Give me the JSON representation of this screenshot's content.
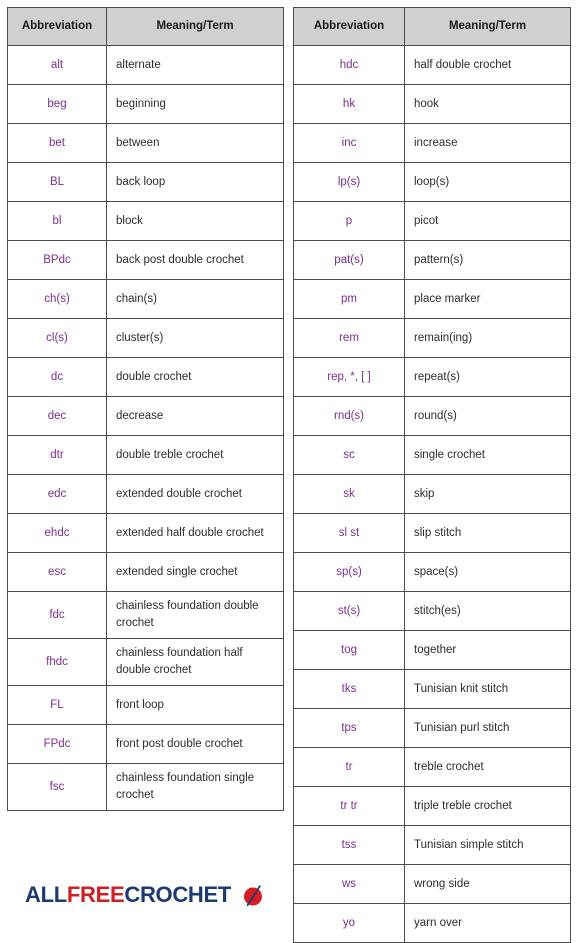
{
  "page": {
    "title": "Crochet Abbreviations Chart",
    "background_color": "#ffffff",
    "abbr_text_color": "#7a2f8f",
    "term_text_color": "#2d2d2d",
    "header_bg_color": "#d0d0d0",
    "border_color": "#4d4d4d"
  },
  "columns": {
    "abbreviation_header": "Abbreviation",
    "meaning_header": "Meaning/Term"
  },
  "left_table": {
    "headers": [
      "Abbreviation",
      "Meaning/Term"
    ],
    "rows": [
      {
        "abbr": "alt",
        "term": "alternate"
      },
      {
        "abbr": "beg",
        "term": "beginning"
      },
      {
        "abbr": "bet",
        "term": "between"
      },
      {
        "abbr": "BL",
        "term": "back loop"
      },
      {
        "abbr": "bl",
        "term": "block"
      },
      {
        "abbr": "BPdc",
        "term": "back post double crochet"
      },
      {
        "abbr": "ch(s)",
        "term": "chain(s)"
      },
      {
        "abbr": "cl(s)",
        "term": "cluster(s)"
      },
      {
        "abbr": "dc",
        "term": "double crochet"
      },
      {
        "abbr": "dec",
        "term": "decrease"
      },
      {
        "abbr": "dtr",
        "term": "double treble crochet"
      },
      {
        "abbr": "edc",
        "term": "extended double crochet"
      },
      {
        "abbr": "ehdc",
        "term": "extended half double crochet"
      },
      {
        "abbr": "esc",
        "term": "extended single crochet"
      },
      {
        "abbr": "fdc",
        "term": "chainless foundation double crochet"
      },
      {
        "abbr": "fhdc",
        "term": "chainless foundation half double crochet"
      },
      {
        "abbr": "FL",
        "term": "front loop"
      },
      {
        "abbr": "FPdc",
        "term": "front post double crochet"
      },
      {
        "abbr": "fsc",
        "term": "chainless foundation single crochet"
      }
    ]
  },
  "right_table": {
    "headers": [
      "Abbreviation",
      "Meaning/Term"
    ],
    "rows": [
      {
        "abbr": "hdc",
        "term": "half double crochet"
      },
      {
        "abbr": "hk",
        "term": "hook"
      },
      {
        "abbr": "inc",
        "term": "increase"
      },
      {
        "abbr": "lp(s)",
        "term": "loop(s)"
      },
      {
        "abbr": "p",
        "term": "picot"
      },
      {
        "abbr": "pat(s)",
        "term": "pattern(s)"
      },
      {
        "abbr": "pm",
        "term": "place marker"
      },
      {
        "abbr": "rem",
        "term": "remain(ing)"
      },
      {
        "abbr": "rep, *, [ ]",
        "term": "repeat(s)"
      },
      {
        "abbr": "rnd(s)",
        "term": "round(s)"
      },
      {
        "abbr": "sc",
        "term": "single crochet"
      },
      {
        "abbr": "sk",
        "term": "skip"
      },
      {
        "abbr": "sl st",
        "term": "slip stitch"
      },
      {
        "abbr": "sp(s)",
        "term": "space(s)"
      },
      {
        "abbr": "st(s)",
        "term": "stitch(es)"
      },
      {
        "abbr": "tog",
        "term": "together"
      },
      {
        "abbr": "tks",
        "term": "Tunisian knit stitch"
      },
      {
        "abbr": "tps",
        "term": "Tunisian purl stitch"
      },
      {
        "abbr": "tr",
        "term": "treble crochet"
      },
      {
        "abbr": "tr tr",
        "term": "triple treble crochet"
      },
      {
        "abbr": "tss",
        "term": "Tunisian simple stitch"
      },
      {
        "abbr": "ws",
        "term": "wrong side"
      },
      {
        "abbr": "yo",
        "term": "yarn over"
      }
    ]
  },
  "logo": {
    "part_all": "ALL",
    "part_free": "FREE",
    "part_crochet": "CROCHET",
    "icon": "yarn-ball-icon",
    "navy": "#1f3a70",
    "red": "#cc2026"
  }
}
